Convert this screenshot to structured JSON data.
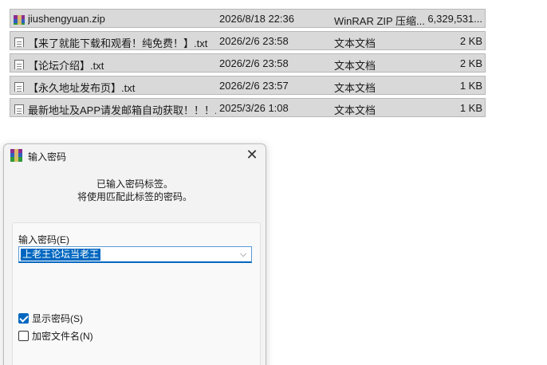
{
  "files": [
    {
      "name": "jiushengyuan.zip",
      "date": "2026/8/18 22:36",
      "type": "WinRAR ZIP 压缩...",
      "size": "6,329,531...",
      "icon": "winrar-archive-icon"
    },
    {
      "name": "【来了就能下载和观看！纯免费！】.txt",
      "date": "2026/2/6 23:58",
      "type": "文本文档",
      "size": "2 KB",
      "icon": "text-file-icon"
    },
    {
      "name": "【论坛介绍】.txt",
      "date": "2026/2/6 23:58",
      "type": "文本文档",
      "size": "2 KB",
      "icon": "text-file-icon"
    },
    {
      "name": "【永久地址发布页】.txt",
      "date": "2026/2/6 23:57",
      "type": "文本文档",
      "size": "1 KB",
      "icon": "text-file-icon"
    },
    {
      "name": "最新地址及APP请发邮箱自动获取！！！....",
      "date": "2025/3/26 1:08",
      "type": "文本文档",
      "size": "1 KB",
      "icon": "text-file-icon"
    }
  ],
  "dialog": {
    "title": "输入密码",
    "message_line1": "已输入密码标签。",
    "message_line2": "将使用匹配此标签的密码。",
    "password_label": "输入密码(E)",
    "password_value": "上老王论坛当老王",
    "show_password_label": "显示密码(S)",
    "show_password_checked": true,
    "encrypt_filenames_label": "加密文件名(N)",
    "encrypt_filenames_checked": false
  },
  "colors": {
    "accent": "#0067c0",
    "row_selected": "#d9d9d9"
  }
}
